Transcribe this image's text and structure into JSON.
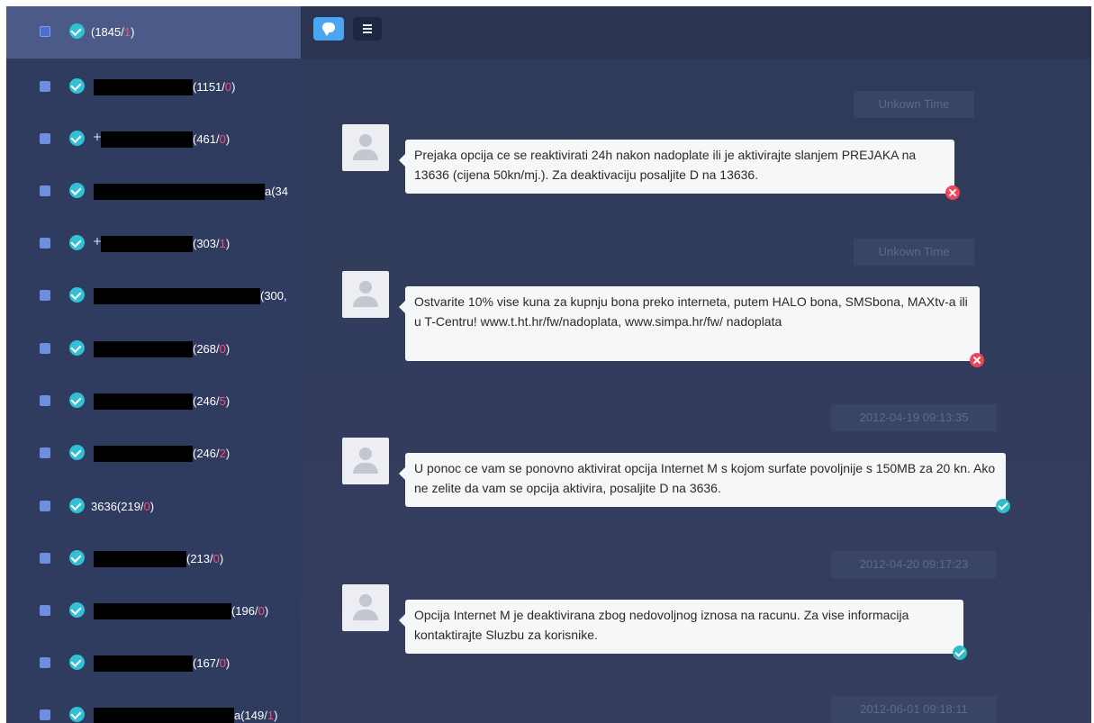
{
  "toolbar": {
    "chat_view_icon": "chat-bubble-icon",
    "list_view_icon": "list-icon"
  },
  "contacts": [
    {
      "prefix": "",
      "label": "(1845/",
      "unread": "1",
      "tail": ")"
    },
    {
      "prefix": "",
      "label": "(1151/",
      "unread": "0",
      "tail": ")"
    },
    {
      "prefix": "+",
      "label": "(461/",
      "unread": "0",
      "tail": ")"
    },
    {
      "prefix": "",
      "label": "a(34",
      "unread": "",
      "tail": ""
    },
    {
      "prefix": "+",
      "label": "(303/",
      "unread": "1",
      "tail": ")"
    },
    {
      "prefix": "",
      "label": "(300,",
      "unread": "",
      "tail": ""
    },
    {
      "prefix": "",
      "label": "(268/",
      "unread": "0",
      "tail": ")"
    },
    {
      "prefix": "",
      "label": "(246/",
      "unread": "5",
      "tail": ")"
    },
    {
      "prefix": "",
      "label": "(246/",
      "unread": "2",
      "tail": ")"
    },
    {
      "prefix": "",
      "label": "3636(219/",
      "unread": "0",
      "tail": ")"
    },
    {
      "prefix": "",
      "label": "(213/",
      "unread": "0",
      "tail": ")"
    },
    {
      "prefix": "",
      "label": "(196/",
      "unread": "0",
      "tail": ")"
    },
    {
      "prefix": "",
      "label": "(167/",
      "unread": "0",
      "tail": ")"
    },
    {
      "prefix": "",
      "label": "a(149/",
      "unread": "1",
      "tail": ")"
    }
  ],
  "messages": [
    {
      "time": "Unkown Time",
      "text": "Prejaka opcija ce se reaktivirati 24h nakon nadoplate ili je aktivirajte slanjem PREJAKA na 13636 (cijena 50kn/mj.). Za deaktivaciju posaljite D na 13636.",
      "status": "failed"
    },
    {
      "time": "Unkown Time",
      "text": "Ostvarite 10% vise kuna za kupnju bona preko interneta, putem HALO bona, SMSbona, MAXtv-a ili u T-Centru! www.t.ht.hr/fw/nadoplata, www.simpa.hr/fw/ nadoplata",
      "status": "failed"
    },
    {
      "time": "2012-04-19 09:13:35",
      "text": "U ponoc ce vam se ponovno aktivirat opcija Internet M s kojom surfate povoljnije s 150MB za 20 kn. Ako ne zelite da vam se opcija aktivira, posaljite D na 3636.",
      "status": "sent"
    },
    {
      "time": "2012-04-20 09:17:23",
      "text": "Opcija Internet M je deaktivirana zbog nedovoljnog iznosa na racunu. Za vise informacija kontaktirajte Sluzbu za korisnike.",
      "status": "sent"
    },
    {
      "time": "2012-06-01 09:18:11"
    }
  ],
  "colors": {
    "sidebar_bg": "#2f3b5f",
    "selected_bg": "#4b5a86",
    "main_bg": "#323b5c",
    "accent_blue": "#4aa6f0",
    "unread_pink": "#ff4d7d",
    "check_teal": "#33c0d6",
    "error_red": "#f0445c"
  }
}
